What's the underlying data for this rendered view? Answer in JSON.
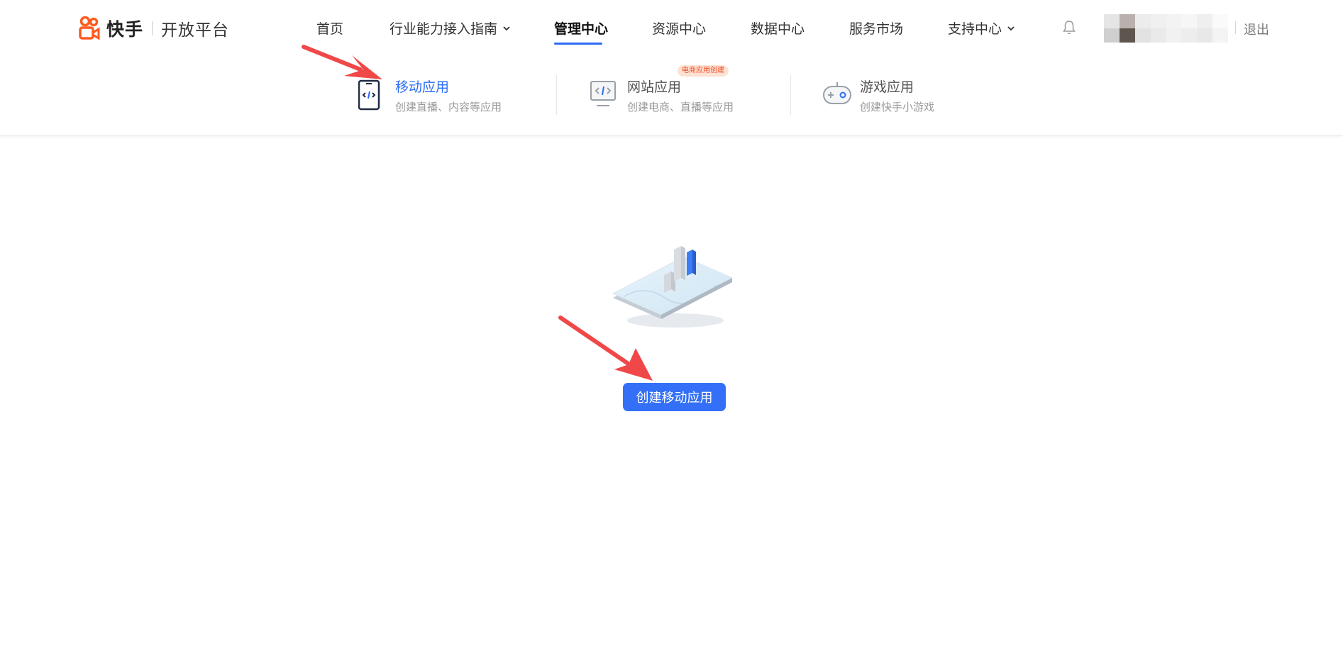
{
  "brand": {
    "name": "快手",
    "sub": "开放平台"
  },
  "nav": {
    "items": [
      {
        "label": "首页"
      },
      {
        "label": "行业能力接入指南"
      },
      {
        "label": "管理中心"
      },
      {
        "label": "资源中心"
      },
      {
        "label": "数据中心"
      },
      {
        "label": "服务市场"
      },
      {
        "label": "支持中心"
      }
    ],
    "logout": "退出"
  },
  "subtabs": [
    {
      "title": "移动应用",
      "desc": "创建直播、内容等应用"
    },
    {
      "title": "网站应用",
      "desc": "创建电商、直播等应用",
      "badge": "电商应用创建"
    },
    {
      "title": "游戏应用",
      "desc": "创建快手小游戏"
    }
  ],
  "main": {
    "create_button": "创建移动应用"
  },
  "colors": {
    "accent": "#3370f7",
    "brand": "#ff5a1f",
    "annotation_arrow": "#f04848"
  }
}
